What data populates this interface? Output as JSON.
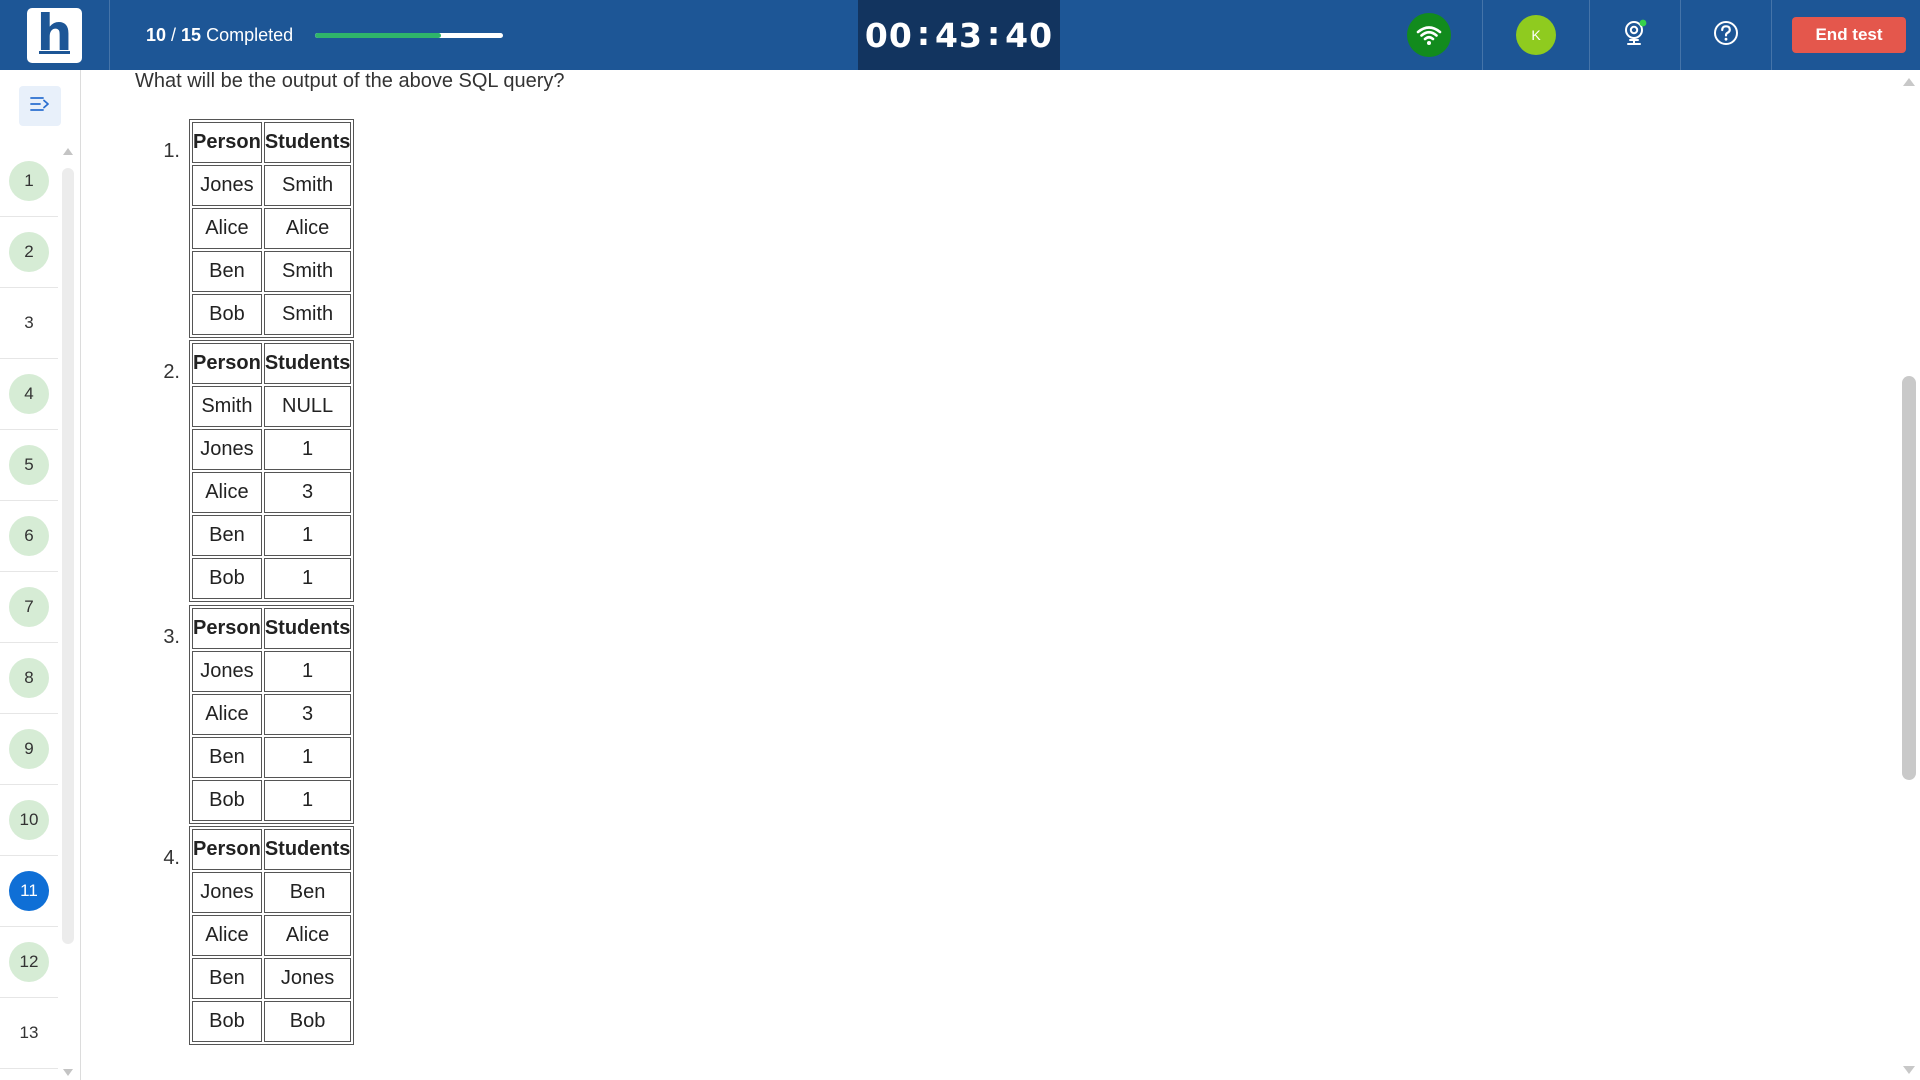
{
  "topbar": {
    "progress": {
      "done": "10",
      "sep": " / ",
      "total": "15",
      "label": " Completed",
      "fraction": 0.667
    },
    "timer": {
      "hh": "00",
      "mm": "43",
      "ss": "40",
      "sep": ":"
    },
    "avatar_initial": "K",
    "end_test_label": "End test",
    "colors": {
      "bar": "#1d5696",
      "timer_bg": "#12345f",
      "end_btn": "#e4574c",
      "wifi": "#128b1d",
      "avatar": "#8fcb1f",
      "progress_fill": "#2fb56a"
    }
  },
  "sidebar": {
    "questions": [
      {
        "n": "1",
        "state": "done"
      },
      {
        "n": "2",
        "state": "done"
      },
      {
        "n": "3",
        "state": "unanswered"
      },
      {
        "n": "4",
        "state": "done"
      },
      {
        "n": "5",
        "state": "done"
      },
      {
        "n": "6",
        "state": "done"
      },
      {
        "n": "7",
        "state": "done"
      },
      {
        "n": "8",
        "state": "done"
      },
      {
        "n": "9",
        "state": "done"
      },
      {
        "n": "10",
        "state": "done"
      },
      {
        "n": "11",
        "state": "current"
      },
      {
        "n": "12",
        "state": "done"
      },
      {
        "n": "13",
        "state": "unanswered"
      }
    ]
  },
  "question": {
    "text": "What will be the output of the above SQL query?",
    "options": [
      {
        "num": "1.",
        "headers": [
          "Person",
          "Students"
        ],
        "rows": [
          [
            "Jones",
            "Smith"
          ],
          [
            "Alice",
            "Alice"
          ],
          [
            "Ben",
            "Smith"
          ],
          [
            "Bob",
            "Smith"
          ]
        ]
      },
      {
        "num": "2.",
        "headers": [
          "Person",
          "Students"
        ],
        "rows": [
          [
            "Smith",
            "NULL"
          ],
          [
            "Jones",
            "1"
          ],
          [
            "Alice",
            "3"
          ],
          [
            "Ben",
            "1"
          ],
          [
            "Bob",
            "1"
          ]
        ]
      },
      {
        "num": "3.",
        "headers": [
          "Person",
          "Students"
        ],
        "rows": [
          [
            "Jones",
            "1"
          ],
          [
            "Alice",
            "3"
          ],
          [
            "Ben",
            "1"
          ],
          [
            "Bob",
            "1"
          ]
        ]
      },
      {
        "num": "4.",
        "headers": [
          "Person",
          "Students"
        ],
        "rows": [
          [
            "Jones",
            "Ben"
          ],
          [
            "Alice",
            "Alice"
          ],
          [
            "Ben",
            "Jones"
          ],
          [
            "Bob",
            "Bob"
          ]
        ]
      }
    ]
  }
}
